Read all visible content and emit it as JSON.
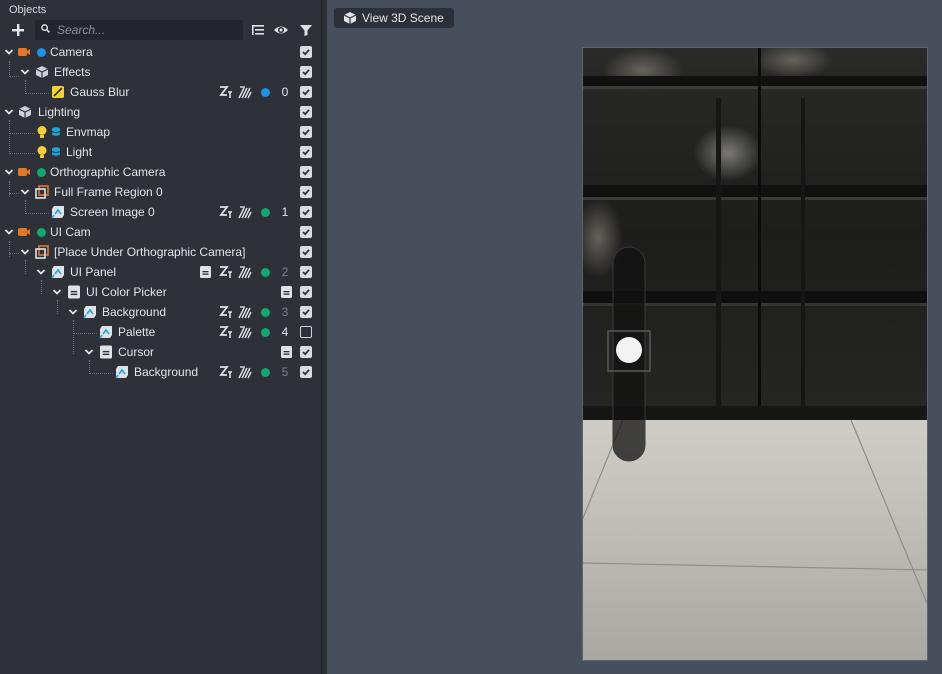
{
  "panel": {
    "title": "Objects",
    "search_placeholder": "Search..."
  },
  "toolbar": {
    "add_icon": "plus-icon",
    "search_icon": "search-icon",
    "hierarchy_icon": "hierarchy-list-icon",
    "visibility_icon": "eye-icon",
    "filter_icon": "filter-icon"
  },
  "tree": {
    "camera": "Camera",
    "effects": "Effects",
    "gauss_blur": "Gauss Blur",
    "gauss_blur_order": "0",
    "lighting": "Lighting",
    "envmap": "Envmap",
    "light": "Light",
    "ortho_camera": "Orthographic Camera",
    "full_frame_region": "Full Frame Region 0",
    "screen_image": "Screen Image 0",
    "screen_image_order": "1",
    "ui_cam": "UI Cam",
    "place_under": "[Place Under Orthographic Camera]",
    "ui_panel": "UI Panel",
    "ui_panel_order": "2",
    "ui_color_picker": "UI Color Picker",
    "background1": "Background",
    "background1_order": "3",
    "palette": "Palette",
    "palette_order": "4",
    "cursor": "Cursor",
    "background2": "Background",
    "background2_order": "5"
  },
  "viewport": {
    "view_button": "View 3D Scene"
  },
  "colors": {
    "accent_blue": "#1e90e6",
    "accent_green": "#13a672",
    "camera_orange": "#e0772a",
    "light_yellow": "#f2d03a"
  }
}
